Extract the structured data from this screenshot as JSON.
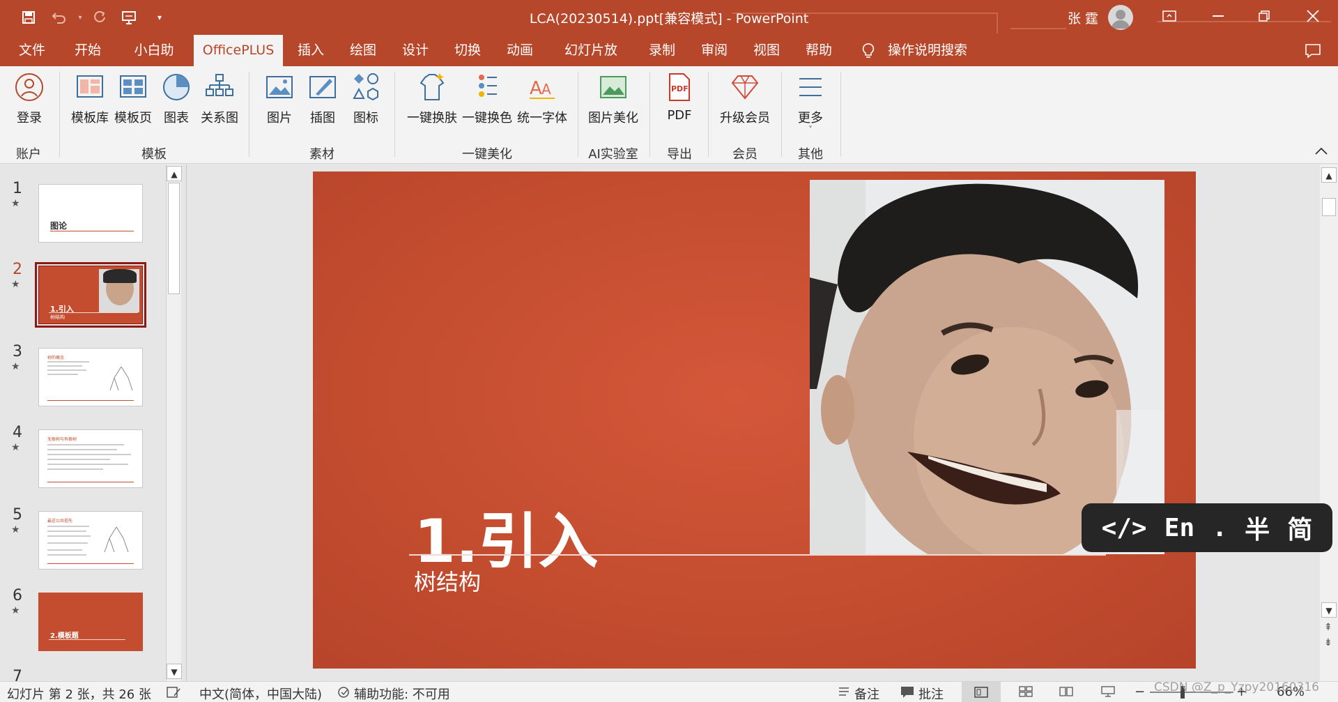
{
  "window": {
    "title": "LCA(20230514).ppt[兼容模式]  -  PowerPoint",
    "user_name": "张 霆"
  },
  "menu": {
    "tabs": [
      {
        "label": "文件"
      },
      {
        "label": "开始"
      },
      {
        "label": "小白助手"
      },
      {
        "label": "OfficePLUS",
        "active": true
      },
      {
        "label": "插入"
      },
      {
        "label": "绘图"
      },
      {
        "label": "设计"
      },
      {
        "label": "切换"
      },
      {
        "label": "动画"
      },
      {
        "label": "幻灯片放映"
      },
      {
        "label": "录制"
      },
      {
        "label": "审阅"
      },
      {
        "label": "视图"
      },
      {
        "label": "帮助"
      }
    ],
    "tell_me": "操作说明搜索"
  },
  "ribbon": {
    "groups": [
      {
        "name": "账户",
        "buttons": [
          "登录"
        ]
      },
      {
        "name": "模板",
        "buttons": [
          "模板库",
          "模板页",
          "图表",
          "关系图"
        ]
      },
      {
        "name": "素材",
        "buttons": [
          "图片",
          "插图",
          "图标"
        ]
      },
      {
        "name": "一键美化",
        "buttons": [
          "一键换肤",
          "一键换色",
          "统一字体"
        ]
      },
      {
        "name": "AI实验室",
        "buttons": [
          "图片美化"
        ]
      },
      {
        "name": "导出",
        "buttons": [
          "PDF"
        ]
      },
      {
        "name": "会员",
        "buttons": [
          "升级会员"
        ]
      },
      {
        "name": "其他",
        "buttons": [
          "更多"
        ]
      }
    ]
  },
  "thumbnails": {
    "items": [
      {
        "number": "1",
        "title": "图论"
      },
      {
        "number": "2",
        "title": "1.引入",
        "subtitle": "树结构",
        "selected": true
      },
      {
        "number": "3",
        "title": "树的概念"
      },
      {
        "number": "4",
        "title": "无根树与有根树"
      },
      {
        "number": "5",
        "title": "最近公共祖先"
      },
      {
        "number": "6",
        "title": "2.模板题"
      },
      {
        "number": "7"
      }
    ]
  },
  "slide": {
    "title": "1.引入",
    "subtitle": "树结构"
  },
  "ime": {
    "items": [
      "</>",
      "En",
      ".",
      "半",
      "简"
    ]
  },
  "status": {
    "slide_info": "幻灯片 第 2 张，共 26 张",
    "language": "中文(简体，中国大陆)",
    "accessibility": "辅助功能: 不可用",
    "notes": "备注",
    "comments": "批注",
    "zoom": "66%"
  },
  "watermark": "CSDN @Z_p_Yzpy20160316",
  "colors": {
    "accent": "#b7472a",
    "slide_bg": "#c8502f"
  }
}
